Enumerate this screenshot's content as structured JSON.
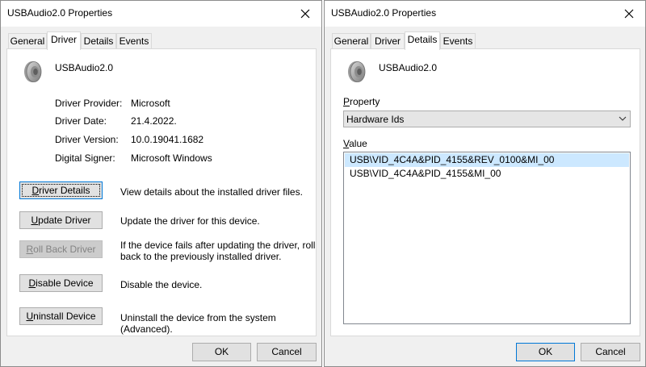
{
  "left": {
    "title": "USBAudio2.0 Properties",
    "tabs": [
      "General",
      "Driver",
      "Details",
      "Events"
    ],
    "device_name": "USBAudio2.0",
    "info": [
      {
        "label": "Driver Provider:",
        "value": "Microsoft"
      },
      {
        "label": "Driver Date:",
        "value": "21.4.2022."
      },
      {
        "label": "Driver Version:",
        "value": "10.0.19041.1682"
      },
      {
        "label": "Digital Signer:",
        "value": "Microsoft Windows"
      }
    ],
    "actions": [
      {
        "button": "Driver Details",
        "mnemonic": "D",
        "rest": "river Details",
        "description": "View details about the installed driver files."
      },
      {
        "button": "Update Driver",
        "mnemonic": "U",
        "rest": "pdate Driver",
        "description": "Update the driver for this device."
      },
      {
        "button": "Roll Back Driver",
        "mnemonic": "R",
        "rest": "oll Back Driver",
        "description_line1": "If the device fails after updating the driver, roll",
        "description_line2": "back to the previously installed driver."
      },
      {
        "button": "Disable Device",
        "mnemonic": "D",
        "rest": "isable Device",
        "description": "Disable the device."
      },
      {
        "button": "Uninstall Device",
        "mnemonic": "U",
        "rest": "ninstall Device",
        "description": "Uninstall the device from the system (Advanced)."
      }
    ],
    "ok": "OK",
    "cancel": "Cancel"
  },
  "right": {
    "title": "USBAudio2.0 Properties",
    "tabs": [
      "General",
      "Driver",
      "Details",
      "Events"
    ],
    "device_name": "USBAudio2.0",
    "property_label": {
      "mnemonic": "P",
      "rest": "roperty"
    },
    "property_value": "Hardware Ids",
    "value_label": {
      "mnemonic": "V",
      "rest": "alue"
    },
    "values": [
      "USB\\VID_4C4A&PID_4155&REV_0100&MI_00",
      "USB\\VID_4C4A&PID_4155&MI_00"
    ],
    "ok": "OK",
    "cancel": "Cancel"
  },
  "icons": {
    "close": "close-icon",
    "device": "speaker-icon",
    "dropdown": "chevron-down-icon"
  },
  "colors": {
    "focus_blue": "#0078d7",
    "selection": "#cce8ff",
    "dialog_bg": "#f0f0f0"
  }
}
